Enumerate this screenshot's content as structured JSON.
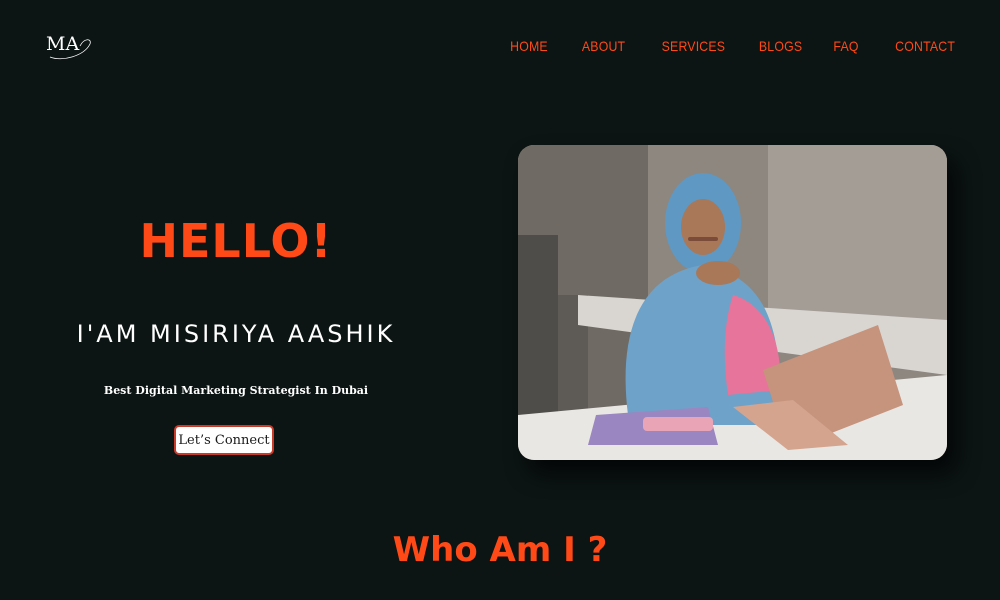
{
  "logo": {
    "text": "MA"
  },
  "nav": {
    "items": [
      {
        "label": "HOME"
      },
      {
        "label": "ABOUT"
      },
      {
        "label": "SERVICES"
      },
      {
        "label": "BLOGS"
      },
      {
        "label": "FAQ"
      },
      {
        "label": "CONTACT"
      }
    ]
  },
  "hero": {
    "greeting": "HELLO!",
    "name": "I'AM MISIRIYA AASHIK",
    "tagline": "Best Digital Marketing Strategist In Dubai",
    "cta_label": "Let’s Connect",
    "photo_icon": "portrait-photo"
  },
  "about": {
    "heading": "Who Am I ?"
  },
  "colors": {
    "background": "#0c1414",
    "accent": "#ff4a17",
    "text": "#ffffff"
  }
}
